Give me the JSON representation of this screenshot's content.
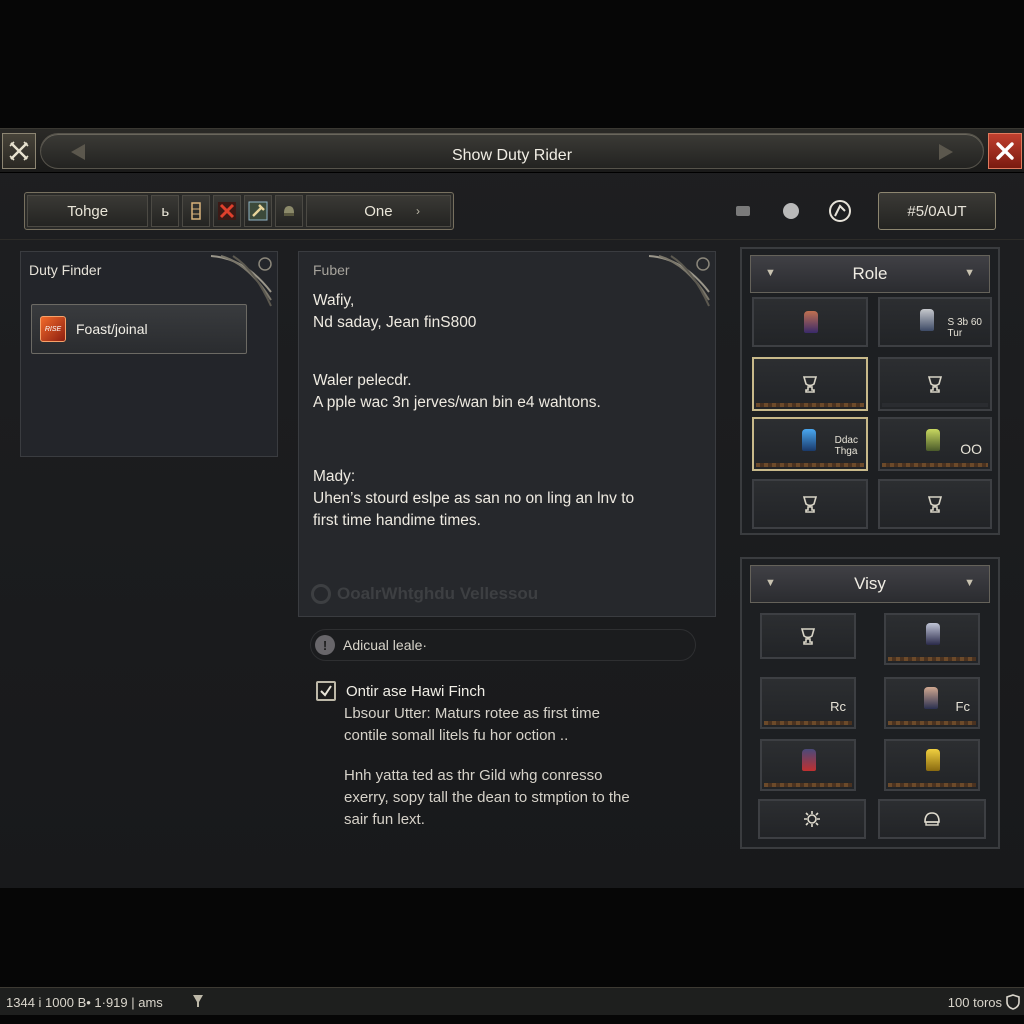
{
  "window": {
    "title": "Show Duty Rider"
  },
  "toolbar": {
    "left_button": "Tohge",
    "small_button": "ь",
    "right_button": "One",
    "right_arrow": "›",
    "load_button": "#5/0AUT"
  },
  "left_panel": {
    "title": "Duty Finder",
    "item": {
      "label": "Foast/joinal",
      "icon_text": "RISE"
    }
  },
  "center_panel": {
    "heading": "Fuber",
    "block1": [
      "Wafiy,",
      "Nd saday, Jean finS800"
    ],
    "block2": [
      "Waler pelecdr.",
      "A pple wac 3n jerves/wan bin e4 wahtons."
    ],
    "block3": [
      "Mady:",
      "Uhen’s stourd eslpe as san no on ling an lnv to",
      "first time handime times."
    ],
    "footer": "OoalrWhtghdu Vellessou"
  },
  "info_bar": {
    "icon": "!",
    "text": "Adicual leale·"
  },
  "checkbox": {
    "label": "Ontir ase Hawi Finch",
    "checked": true
  },
  "descriptions": {
    "para1": [
      "Lbsour Utter: Maturs rotee as first time",
      "contile somall litels fu hor oction .."
    ],
    "para2": [
      "Hnh yatta ted as thr Gild whg conresso",
      "exerry, sopy tall the dean to stmption to the",
      "sair fun lext."
    ]
  },
  "role_panel": {
    "title": "Role",
    "slots": [
      {
        "text": ""
      },
      {
        "text": "S 3b 60\nTur"
      },
      {
        "text": ""
      },
      {
        "text": ""
      },
      {
        "text": "Ddac\nThga"
      },
      {
        "text": "OO"
      },
      {
        "text": ""
      },
      {
        "text": ""
      }
    ]
  },
  "visy_panel": {
    "title": "Visy",
    "slots": [
      {
        "text": ""
      },
      {
        "text": ""
      },
      {
        "text": "Rc"
      },
      {
        "text": "Fc"
      },
      {
        "text": ""
      },
      {
        "text": ""
      }
    ]
  },
  "statusbar": {
    "left": "1344 i 1000 B• 1·919 | ams",
    "right": "100 toros"
  },
  "colors": {
    "accent_gold": "#c8b98a",
    "close_red": "#b02e20",
    "duty_orange": "#f26a2a"
  }
}
